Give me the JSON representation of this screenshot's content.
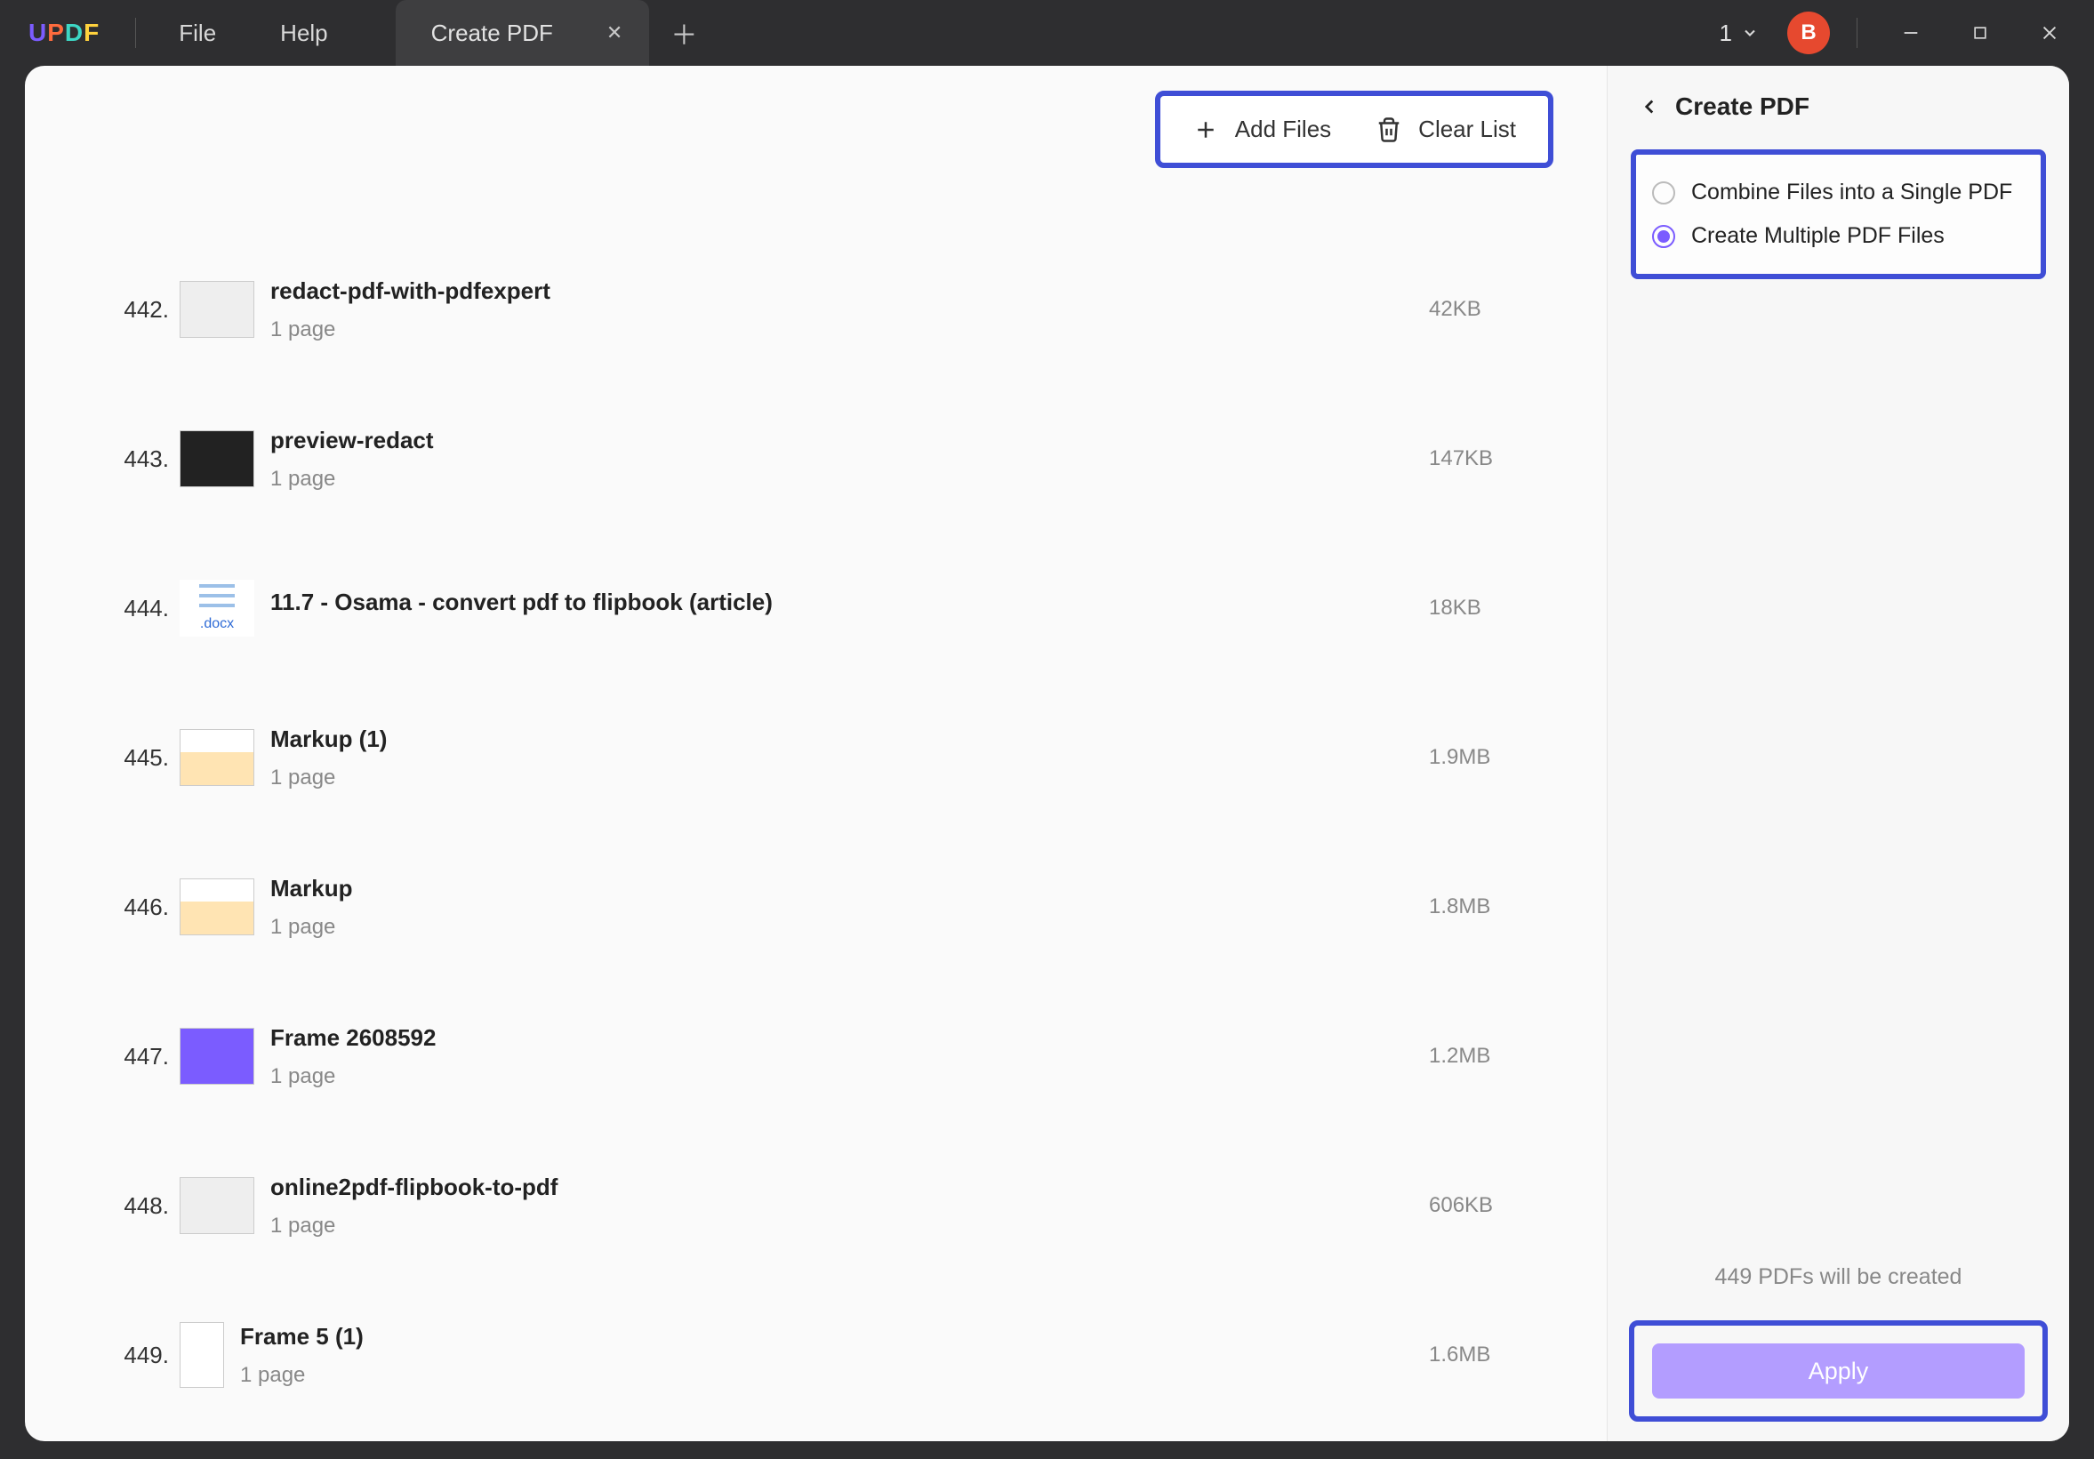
{
  "titlebar": {
    "logo": {
      "u": "U",
      "p": "P",
      "d": "D",
      "f": "F"
    },
    "menu": {
      "file": "File",
      "help": "Help"
    },
    "tab": {
      "label": "Create PDF"
    },
    "count": "1",
    "avatar": "B"
  },
  "actions": {
    "add_files": "Add Files",
    "clear_list": "Clear List"
  },
  "files": [
    {
      "index": "442.",
      "name": "redact-pdf-with-pdfexpert",
      "pages": "1 page",
      "size": "42KB",
      "thumb": "grey"
    },
    {
      "index": "443.",
      "name": "preview-redact",
      "pages": "1 page",
      "size": "147KB",
      "thumb": "dark"
    },
    {
      "index": "444.",
      "name": "11.7 - Osama - convert pdf to flipbook (article)",
      "pages": "",
      "size": "18KB",
      "thumb": "docx",
      "ext": ".docx"
    },
    {
      "index": "445.",
      "name": "Markup (1)",
      "pages": "1 page",
      "size": "1.9MB",
      "thumb": "mix"
    },
    {
      "index": "446.",
      "name": "Markup",
      "pages": "1 page",
      "size": "1.8MB",
      "thumb": "mix"
    },
    {
      "index": "447.",
      "name": "Frame 2608592",
      "pages": "1 page",
      "size": "1.2MB",
      "thumb": "purple"
    },
    {
      "index": "448.",
      "name": "online2pdf-flipbook-to-pdf",
      "pages": "1 page",
      "size": "606KB",
      "thumb": "grey"
    },
    {
      "index": "449.",
      "name": "Frame 5 (1)",
      "pages": "1 page",
      "size": "1.6MB",
      "thumb": "narrow"
    }
  ],
  "sidebar": {
    "title": "Create PDF",
    "option_combine": "Combine Files into a Single PDF",
    "option_multiple": "Create Multiple PDF Files",
    "selected": "multiple",
    "status": "449 PDFs will be created",
    "apply": "Apply"
  }
}
